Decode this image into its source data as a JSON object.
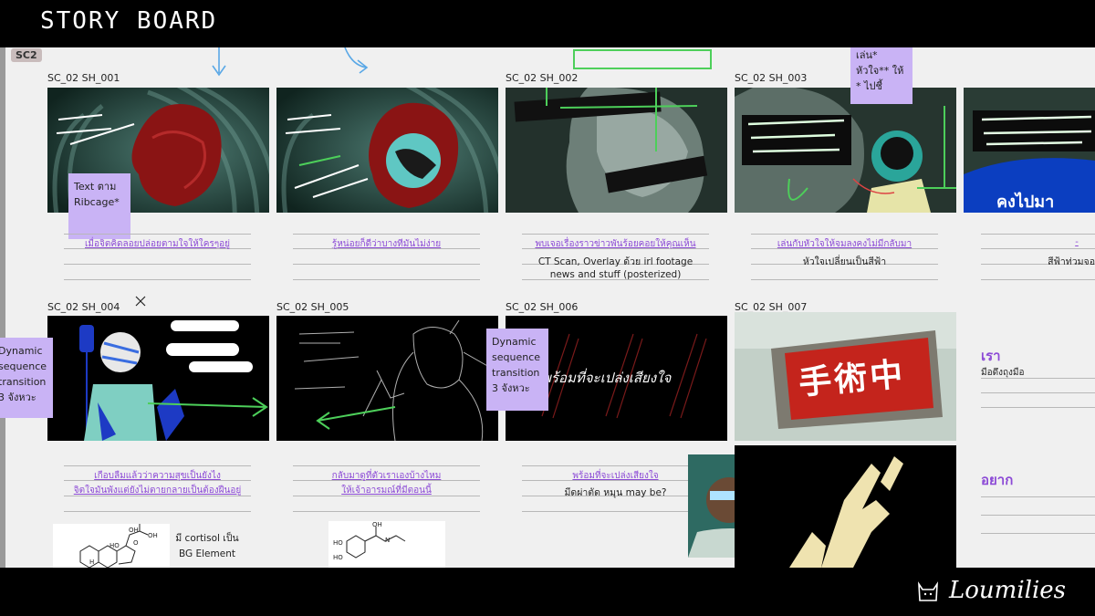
{
  "header": {
    "title": "STORY BOARD"
  },
  "brand": {
    "name": "Loumilies"
  },
  "section_badge": "SC2",
  "shots": [
    {
      "id": "sh001",
      "label": "SC_02 SH_001"
    },
    {
      "id": "sh002",
      "label": "SC_02 SH_002"
    },
    {
      "id": "sh003",
      "label": "SC_02 SH_003"
    },
    {
      "id": "sh004",
      "label": "SC_02 SH_004"
    },
    {
      "id": "sh005",
      "label": "SC_02 SH_005"
    },
    {
      "id": "sh006",
      "label": "SC_02 SH_006"
    },
    {
      "id": "sh007",
      "label": "SC_02 SH_007"
    }
  ],
  "stickies": {
    "ribcage": "Text ตาม Ribcage*",
    "dyn_left": "Dynamic sequence transition 3 จังหวะ",
    "dyn_mid": "Dynamic sequence transition 3 จังหวะ",
    "top_right": "เล่น* หัวใจ** ให้ * ไปชี้"
  },
  "captions": {
    "r1_c1": "เมื่อจิตคิดลอยปล่อยตามใจให้ใครๆอยู่",
    "r1_c2": "รู้หน่อยก็ดีว่าบางทีมันไม่ง่าย",
    "r1_c3": "พบเจอเรื่องราวข่าวพันร้อยคอยให้คุณเห็น",
    "r1_c3_note1": "CT Scan, Overlay ด้วย irl footage",
    "r1_c3_note2": "news and stuff (posterized)",
    "r1_c4": "เล่นกับหัวใจให้จมลงคงไม่มีกลับมา",
    "r1_c4_note": "หัวใจเปลี่ยนเป็นสีฟ้า",
    "r1_c5": "-",
    "r1_c5_note": "สีฟ้าท่วมจอ",
    "r2_c1a": "เกือบลืมแล้วว่าความสุขเป็นยังไง",
    "r2_c1b": "จิตใจมันพังแต่ยังไม่ตายกลายเป็นต้องฝืนอยู่",
    "r2_c2a": "กลับมาดูที่ตัวเราเองบ้างไหม",
    "r2_c2b": "ให้เจ้าอารมณ์ที่มีตอนนี้",
    "r2_c3a": "พร้อมที่จะเปล่งเสียงใจ",
    "r2_c3b": "มีดผ่าตัด หมุน may be?",
    "right_1": "เรา",
    "right_1_note": "มือดึงถุงมือ",
    "right_2": "อยาก",
    "cortisol_note": "มี cortisol เป็น BG Element"
  },
  "frame_text": {
    "sh006_script": "พร้อมที่จะเปล่งเสียงใจ",
    "sh007_sign": "手術中",
    "sh003b_text": "คงไปมา"
  },
  "molecules": {
    "cortisol": {
      "oh1": "OH",
      "oh2": "OH",
      "o": "O",
      "ho": "HO",
      "h": "H"
    },
    "adrenaline": {
      "ho1": "HO",
      "ho2": "HO",
      "oh": "OH",
      "n": "N"
    }
  },
  "colors": {
    "accent_purple": "#8c4ad6",
    "sticky": "#c9b3f5",
    "arrow_green": "#4dcf5a",
    "arrow_blue": "#5aa8e6"
  }
}
